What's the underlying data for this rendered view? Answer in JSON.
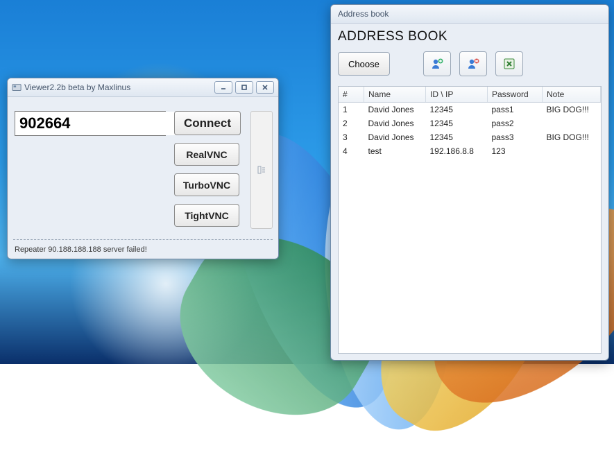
{
  "viewer": {
    "title": "Viewer2.2b beta by Maxlinus",
    "server_value": "902664",
    "buttons": {
      "connect": "Connect",
      "realvnc": "RealVNC",
      "turbovnc": "TurboVNC",
      "tightvnc": "TightVNC"
    },
    "status": "Repeater 90.188.188.188 server failed!"
  },
  "addressbook": {
    "window_title": "Address book",
    "heading": "ADDRESS BOOK",
    "choose_label": "Choose",
    "columns": {
      "num": "#",
      "name": "Name",
      "idip": "ID \\ IP",
      "password": "Password",
      "note": "Note"
    },
    "rows": [
      {
        "num": "1",
        "name": "David Jones",
        "idip": "12345",
        "password": "pass1",
        "note": "BIG DOG!!!"
      },
      {
        "num": "2",
        "name": "David Jones",
        "idip": "12345",
        "password": "pass2",
        "note": ""
      },
      {
        "num": "3",
        "name": "David Jones",
        "idip": "12345",
        "password": "pass3",
        "note": "BIG DOG!!!"
      },
      {
        "num": "4",
        "name": "test",
        "idip": "192.186.8.8",
        "password": "123",
        "note": ""
      }
    ]
  }
}
